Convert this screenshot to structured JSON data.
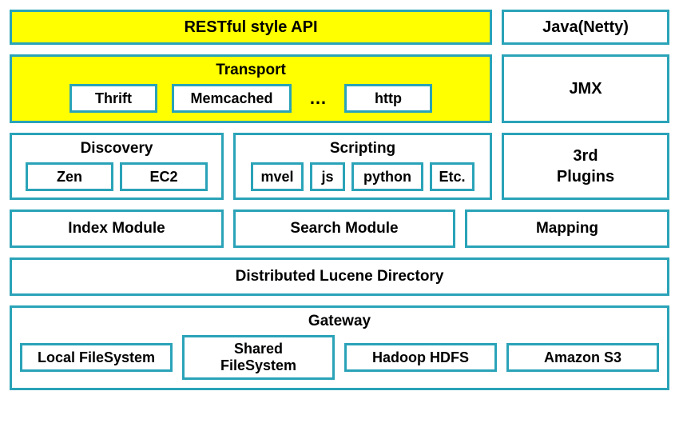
{
  "row1": {
    "api": "RESTful style API",
    "java": "Java(Netty)"
  },
  "row2": {
    "transport": {
      "title": "Transport",
      "thrift": "Thrift",
      "memcached": "Memcached",
      "dots": "…",
      "http": "http"
    },
    "jmx": "JMX"
  },
  "row3": {
    "discovery": {
      "title": "Discovery",
      "zen": "Zen",
      "ec2": "EC2"
    },
    "scripting": {
      "title": "Scripting",
      "mvel": "mvel",
      "js": "js",
      "python": "python",
      "etc": "Etc."
    },
    "plugins": "3rd\nPlugins"
  },
  "row4": {
    "index": "Index Module",
    "search": "Search Module",
    "mapping": "Mapping"
  },
  "row5": {
    "lucene": "Distributed Lucene Directory"
  },
  "row6": {
    "gateway": {
      "title": "Gateway",
      "local": "Local FileSystem",
      "shared": "Shared FileSystem",
      "hdfs": "Hadoop HDFS",
      "s3": "Amazon S3"
    }
  }
}
